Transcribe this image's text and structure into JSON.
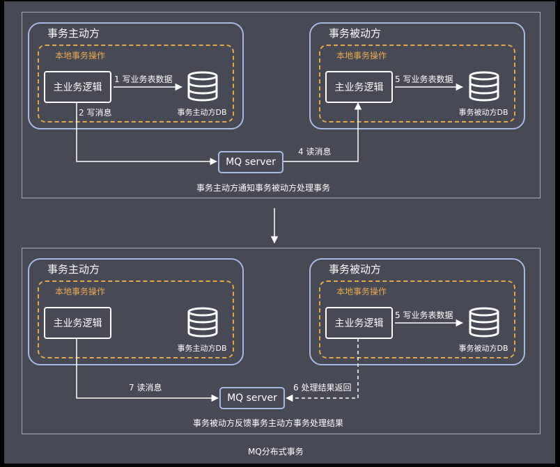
{
  "footer_title": "MQ分布式事务",
  "top": {
    "caption": "事务主动方通知事务被动方处理事务",
    "mq_label": "MQ server",
    "active": {
      "title": "事务主动方",
      "local_title": "本地事务操作",
      "logic_label": "主业务逻辑",
      "db_label": "事务主动方DB",
      "write_table_label": "1 写业务表数据"
    },
    "passive": {
      "title": "事务被动方",
      "local_title": "本地事务操作",
      "logic_label": "主业务逻辑",
      "db_label": "事务被动方DB",
      "write_table_label": "5 写业务表数据"
    },
    "write_msg_label": "2 写消息",
    "read_msg_label": "4 读消息"
  },
  "bottom": {
    "caption": "事务被动方反馈事务主动方事务处理结果",
    "mq_label": "MQ server",
    "active": {
      "title": "事务主动方",
      "local_title": "本地事务操作",
      "logic_label": "主业务逻辑",
      "db_label": "事务主动方DB"
    },
    "passive": {
      "title": "事务被动方",
      "local_title": "本地事务操作",
      "logic_label": "主业务逻辑",
      "db_label": "事务被动方DB",
      "write_table_label": "5 写业务表数据"
    },
    "read_msg_label": "7 读消息",
    "result_return_label": "6 处理结果返回"
  },
  "colors": {
    "background": "#474a55",
    "party_border": "#a9b9e6",
    "local_border": "#e7a84a",
    "text": "#ffffff"
  }
}
